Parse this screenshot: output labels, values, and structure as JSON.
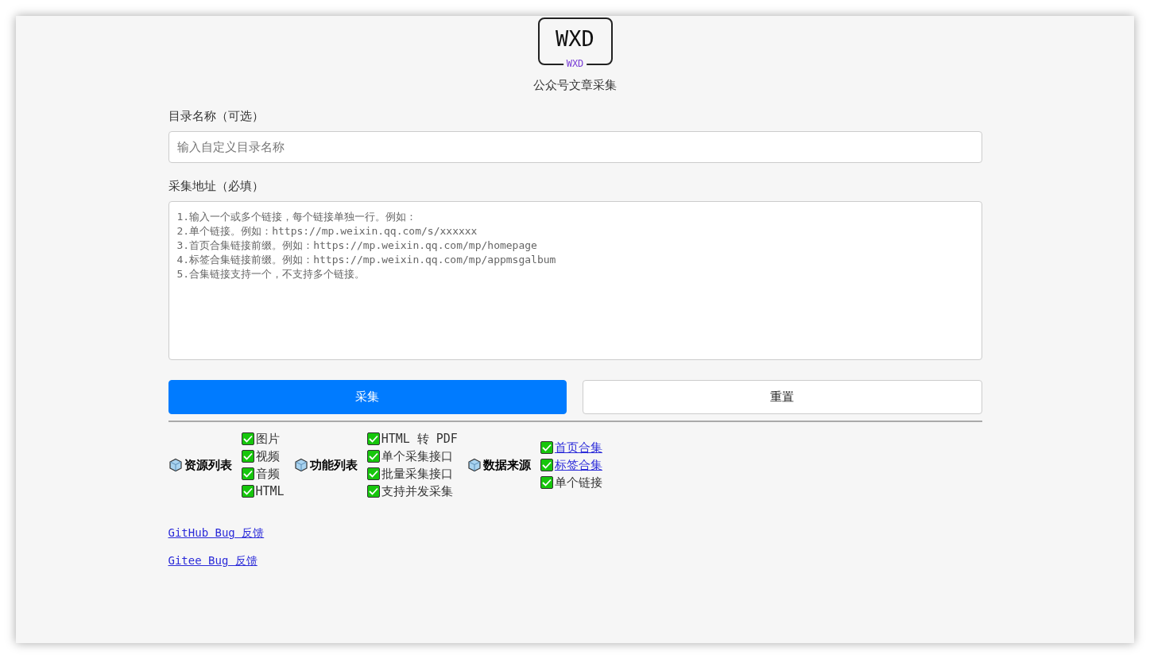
{
  "logo": {
    "title": "WXD",
    "subtitle": "WXD"
  },
  "app_title": "公众号文章采集",
  "dir_field": {
    "label": "目录名称（可选）",
    "placeholder": "输入自定义目录名称"
  },
  "url_field": {
    "label": "采集地址（必填）",
    "placeholder": "1.输入一个或多个链接，每个链接单独一行。例如：\n2.单个链接。例如：https://mp.weixin.qq.com/s/xxxxxx\n3.首页合集链接前缀。例如：https://mp.weixin.qq.com/mp/homepage\n4.标签合集链接前缀。例如：https://mp.weixin.qq.com/mp/appmsgalbum\n5.合集链接支持一个，不支持多个链接。"
  },
  "buttons": [
    {
      "label": "采集",
      "kind": "primary"
    },
    {
      "label": "重置",
      "kind": "secondary"
    }
  ],
  "features": [
    {
      "title": "资源列表",
      "items": [
        {
          "label": "图片",
          "checked": true,
          "kind": "text"
        },
        {
          "label": "视频",
          "checked": true,
          "kind": "text"
        },
        {
          "label": "音频",
          "checked": true,
          "kind": "text"
        },
        {
          "label": "HTML",
          "checked": true,
          "kind": "text"
        }
      ]
    },
    {
      "title": "功能列表",
      "items": [
        {
          "label": "HTML 转 PDF",
          "checked": true,
          "kind": "text"
        },
        {
          "label": "单个采集接口",
          "checked": true,
          "kind": "text"
        },
        {
          "label": "批量采集接口",
          "checked": true,
          "kind": "text"
        },
        {
          "label": "支持并发采集",
          "checked": true,
          "kind": "text"
        }
      ]
    },
    {
      "title": "数据来源",
      "items": [
        {
          "label": "首页合集",
          "checked": true,
          "kind": "link"
        },
        {
          "label": "标签合集",
          "checked": true,
          "kind": "link"
        },
        {
          "label": "单个链接",
          "checked": true,
          "kind": "text"
        }
      ]
    }
  ],
  "links": [
    "GitHub Bug 反馈",
    "Gitee Bug 反馈"
  ]
}
